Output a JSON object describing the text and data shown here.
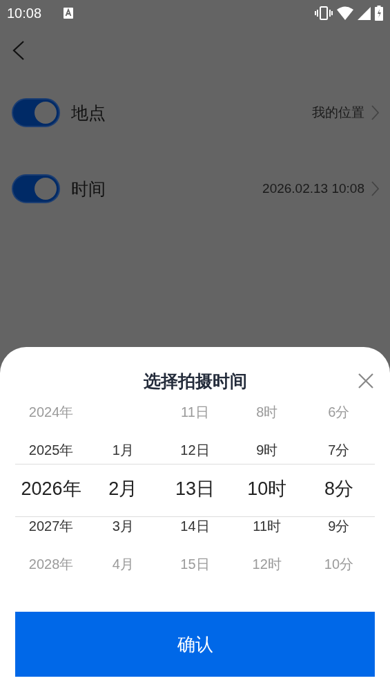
{
  "status_bar": {
    "time": "10:08"
  },
  "settings": [
    {
      "label": "地点",
      "on": true,
      "value": "我的位置"
    },
    {
      "label": "时间",
      "on": true,
      "value": "2026.02.13 10:08"
    }
  ],
  "sheet": {
    "title": "选择拍摄时间",
    "columns": [
      {
        "items": [
          {
            "label": "2024年",
            "selected": false
          },
          {
            "label": "2025年",
            "selected": false
          },
          {
            "label": "2026年",
            "selected": true
          },
          {
            "label": "2027年",
            "selected": false
          },
          {
            "label": "2028年",
            "selected": false
          }
        ]
      },
      {
        "items": [
          {
            "label": "1月",
            "selected": false
          },
          {
            "label": "2月",
            "selected": true
          },
          {
            "label": "3月",
            "selected": false
          },
          {
            "label": "4月",
            "selected": false
          }
        ]
      },
      {
        "items": [
          {
            "label": "11日",
            "selected": false
          },
          {
            "label": "12日",
            "selected": false
          },
          {
            "label": "13日",
            "selected": true
          },
          {
            "label": "14日",
            "selected": false
          },
          {
            "label": "15日",
            "selected": false
          }
        ]
      },
      {
        "items": [
          {
            "label": "8时",
            "selected": false
          },
          {
            "label": "9时",
            "selected": false
          },
          {
            "label": "10时",
            "selected": true
          },
          {
            "label": "11时",
            "selected": false
          },
          {
            "label": "12时",
            "selected": false
          }
        ]
      },
      {
        "items": [
          {
            "label": "6分",
            "selected": false
          },
          {
            "label": "7分",
            "selected": false
          },
          {
            "label": "8分",
            "selected": true
          },
          {
            "label": "9分",
            "selected": false
          },
          {
            "label": "10分",
            "selected": false
          }
        ]
      }
    ],
    "confirm": "确认"
  }
}
